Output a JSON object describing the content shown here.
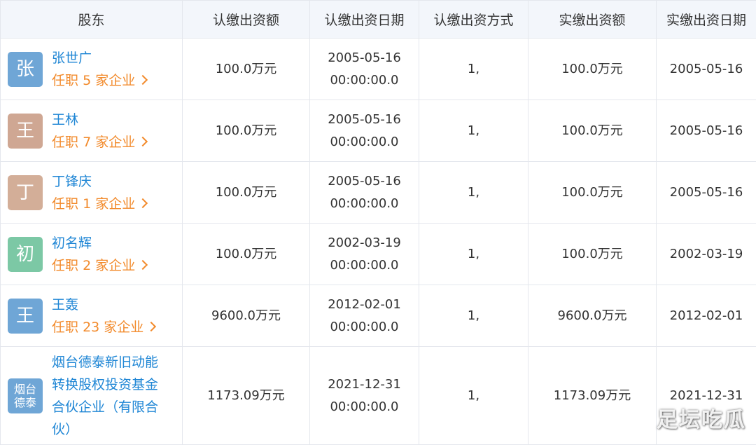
{
  "headers": [
    "股东",
    "认缴出资额",
    "认缴出资日期",
    "认缴出资方式",
    "实缴出资额",
    "实缴出资日期"
  ],
  "rows": [
    {
      "avatar": "张",
      "avatar_color": "#6fa6d6",
      "name": "张世广",
      "posts_prefix": "任职",
      "posts_count": "5",
      "posts_suffix": "家企业",
      "subscribed_amount": "100.0万元",
      "subscribed_date_1": "2005-05-16",
      "subscribed_date_2": "00:00:00.0",
      "method": "1,",
      "paid_amount": "100.0万元",
      "paid_date": "2005-05-16"
    },
    {
      "avatar": "王",
      "avatar_color": "#cfa793",
      "name": "王林",
      "posts_prefix": "任职",
      "posts_count": "7",
      "posts_suffix": "家企业",
      "subscribed_amount": "100.0万元",
      "subscribed_date_1": "2005-05-16",
      "subscribed_date_2": "00:00:00.0",
      "method": "1,",
      "paid_amount": "100.0万元",
      "paid_date": "2005-05-16"
    },
    {
      "avatar": "丁",
      "avatar_color": "#d3ae98",
      "name": "丁锋庆",
      "posts_prefix": "任职",
      "posts_count": "1",
      "posts_suffix": "家企业",
      "subscribed_amount": "100.0万元",
      "subscribed_date_1": "2005-05-16",
      "subscribed_date_2": "00:00:00.0",
      "method": "1,",
      "paid_amount": "100.0万元",
      "paid_date": "2005-05-16"
    },
    {
      "avatar": "初",
      "avatar_color": "#7cc8a5",
      "name": "初名辉",
      "posts_prefix": "任职",
      "posts_count": "2",
      "posts_suffix": "家企业",
      "subscribed_amount": "100.0万元",
      "subscribed_date_1": "2002-03-19",
      "subscribed_date_2": "00:00:00.0",
      "method": "1,",
      "paid_amount": "100.0万元",
      "paid_date": "2002-03-19"
    },
    {
      "avatar": "王",
      "avatar_color": "#6fa6d6",
      "name": "王轰",
      "posts_prefix": "任职",
      "posts_count": "23",
      "posts_suffix": "家企业",
      "subscribed_amount": "9600.0万元",
      "subscribed_date_1": "2012-02-01",
      "subscribed_date_2": "00:00:00.0",
      "method": "1,",
      "paid_amount": "9600.0万元",
      "paid_date": "2012-02-01"
    },
    {
      "avatar": "烟台德泰",
      "avatar_color": "#6fa6d6",
      "name": "烟台德泰新旧动能转换股权投资基金合伙企业（有限合伙）",
      "subscribed_amount": "1173.09万元",
      "subscribed_date_1": "2021-12-31",
      "subscribed_date_2": "00:00:00.0",
      "method": "1,",
      "paid_amount": "1173.09万元",
      "paid_date": "2021-12-31"
    }
  ],
  "watermark": "足坛吃瓜"
}
